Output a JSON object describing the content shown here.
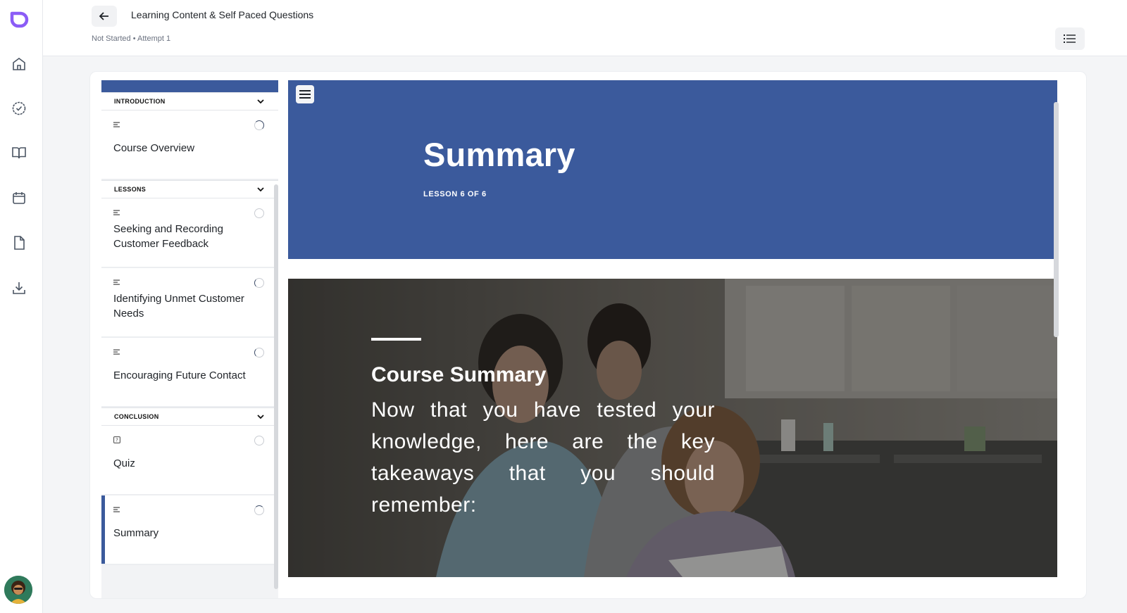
{
  "header": {
    "title": "Learning Content & Self Paced Questions",
    "status": "Not Started",
    "separator": "•",
    "attempt": "Attempt 1"
  },
  "rail": {
    "items": [
      "home-icon",
      "check-circle-icon",
      "book-icon",
      "calendar-icon",
      "document-icon",
      "download-icon"
    ]
  },
  "outline": {
    "sections": [
      {
        "title": "INTRODUCTION",
        "lessons": [
          {
            "label": "Course Overview",
            "type": "text"
          }
        ]
      },
      {
        "title": "LESSONS",
        "lessons": [
          {
            "label": "Seeking and Recording Customer Feedback",
            "type": "text"
          },
          {
            "label": "Identifying Unmet Customer Needs",
            "type": "text"
          },
          {
            "label": "Encouraging Future Contact",
            "type": "text"
          }
        ]
      },
      {
        "title": "CONCLUSION",
        "lessons": [
          {
            "label": "Quiz",
            "type": "quiz"
          },
          {
            "label": "Summary",
            "type": "text",
            "active": true
          }
        ]
      }
    ]
  },
  "main": {
    "title": "Summary",
    "lesson_count": "LESSON 6 OF 6",
    "heading": "Course Summary",
    "body": "Now that you have tested your knowledge, here are the key takeaways that you should remember:"
  },
  "colors": {
    "accent": "#3b5a9c",
    "brand": "#8b5cf6"
  }
}
